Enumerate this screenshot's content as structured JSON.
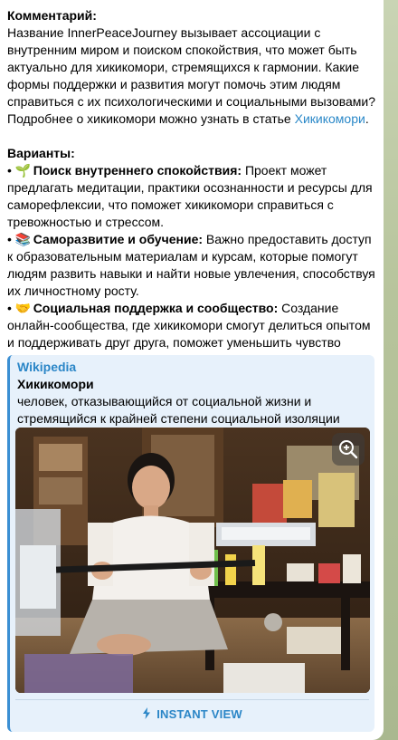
{
  "message": {
    "comment_heading": "Комментарий:",
    "comment_text": "Название InnerPeaceJourney вызывает ассоциации с внутренним миром и поиском спокойствия, что может быть актуально для хикикомори, стремящихся к гармонии. Какие формы поддержки и развития могут помочь этим людям справиться с их психологическими и социальными вызовами? Подробнее о хикикомори можно узнать в статье ",
    "comment_link": "Хикикомори",
    "comment_end": ".",
    "variants_heading": "Варианты:",
    "variants": [
      {
        "emoji": "🌱",
        "title": "Поиск внутреннего спокойствия:",
        "text": " Проект может предлагать медитации, практики осознанности и ресурсы для саморефлексии, что поможет хикикомори справиться с тревожностью и стрессом."
      },
      {
        "emoji": "📚",
        "title": "Саморазвитие и обучение:",
        "text": " Важно предоставить доступ к образовательным материалам и курсам, которые помогут людям развить навыки и найти новые увлечения, способствуя их личностному росту."
      },
      {
        "emoji": "🤝",
        "title": "Социальная поддержка и сообщество:",
        "text": " Создание онлайн-сообщества, где хикикомори смогут делиться опытом и поддерживать друг друга, поможет уменьшить чувство изоляции и одиночества."
      }
    ]
  },
  "preview": {
    "site": "Wikipedia",
    "title": "Хикикомори",
    "description": "человек, отказывающийся от социальной жизни и стремящийся к крайней степени социальной изоляции",
    "zoom_icon": "zoom-in-icon",
    "instant_view_icon": "lightning-icon",
    "instant_view_label": "INSTANT VIEW"
  },
  "colors": {
    "link": "#2a88c8",
    "accent_bar": "#3b8fd3",
    "preview_bg": "#e7f1fb",
    "chat_bg": "#b7c49c"
  }
}
